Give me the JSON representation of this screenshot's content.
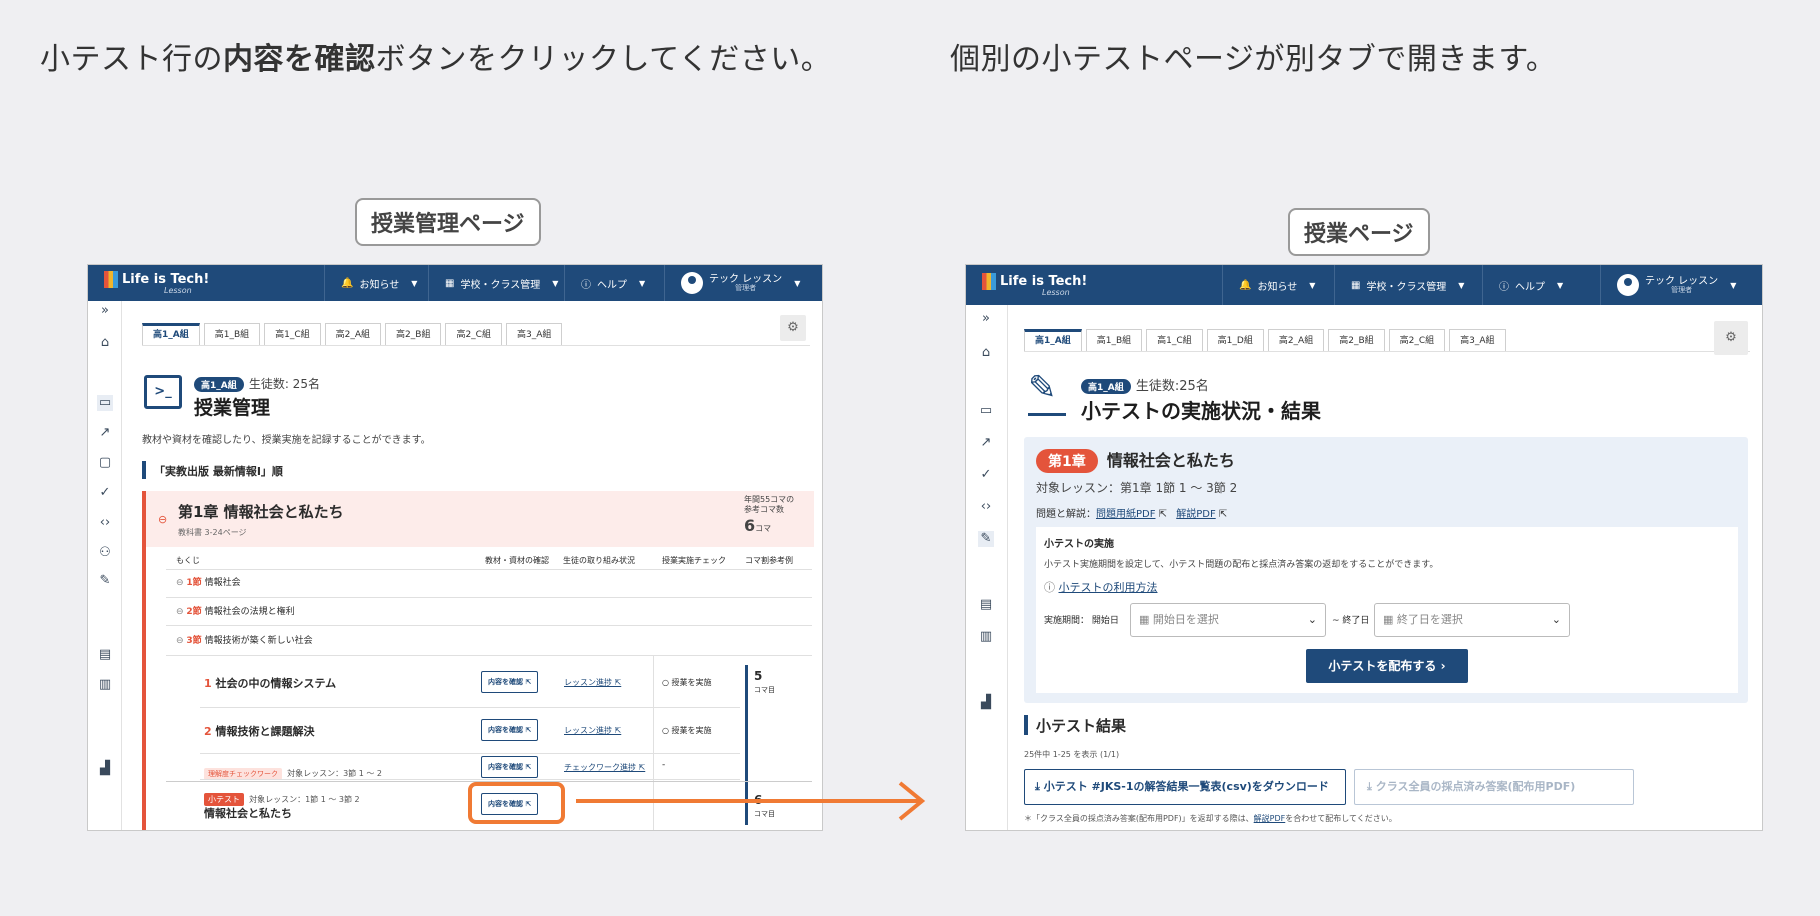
{
  "captions": {
    "left_prefix": "小テスト行の",
    "left_bold": "内容を確認",
    "left_suffix": "ボタンをクリックしてください。",
    "right": "個別の小テストページが別タブで開きます。"
  },
  "labels": {
    "left": "授業管理ページ",
    "right": "授業ページ"
  },
  "topbar": {
    "logo": "Life is Tech!",
    "logo_sub": "Lesson",
    "notice": "お知らせ",
    "school": "学校・クラス管理",
    "help": "ヘルプ",
    "user_name": "テック レッスン",
    "user_role": "管理者"
  },
  "left": {
    "tabs": [
      "高1_A組",
      "高1_B組",
      "高1_C組",
      "高2_A組",
      "高2_B組",
      "高2_C組",
      "高3_A組"
    ],
    "class_badge": "高1_A組",
    "students": "生徒数: 25名",
    "title": "授業管理",
    "description": "教材や資材を確認したり、授業実施を記録することができます。",
    "textbook": "「実教出版 最新情報Ⅰ」順",
    "chapter_title": "第1章 情報社会と私たち",
    "chapter_pages": "教科書 3-24ページ",
    "annual_label": "年間55コマの",
    "annual_label2": "参考コマ数",
    "annual_value": "6",
    "annual_unit": "コマ",
    "col_toc": "もくじ",
    "col_material": "教材・資材の確認",
    "col_progress": "生徒の取り組み状況",
    "col_check": "授業実施チェック",
    "col_ref": "コマ割参考例",
    "sections": [
      {
        "num": "1節",
        "title": "情報社会"
      },
      {
        "num": "2節",
        "title": "情報社会の法規と権利"
      },
      {
        "num": "3節",
        "title": "情報技術が築く新しい社会"
      }
    ],
    "lesson1_num": "1",
    "lesson1_title": "社会の中の情報システム",
    "lesson2_num": "2",
    "lesson2_title": "情報技術と課題解決",
    "check_btn": "内容を確認",
    "progress_link": "レッスン進捗",
    "implement": "授業を実施",
    "understanding_badge": "理解度チェックワーク",
    "understanding_target": "対象レッスン：3節 1 ～ 2",
    "checkwork_link": "チェックワーク進捗",
    "dash": "-",
    "quiz_badge": "小テスト",
    "quiz_target": "対象レッスン：1節 1 ～ 3節 2",
    "quiz_title": "情報社会と私たち",
    "koma5": "5",
    "koma6": "6",
    "koma_unit": "コマ目"
  },
  "right": {
    "tabs": [
      "高1_A組",
      "高1_B組",
      "高1_C組",
      "高1_D組",
      "高2_A組",
      "高2_B組",
      "高2_C組",
      "高3_A組"
    ],
    "class_badge": "高1_A組",
    "students": "生徒数:25名",
    "title": "小テストの実施状況・結果",
    "chapter_badge": "第1章",
    "chapter_title": "情報社会と私たち",
    "target": "対象レッスン：第1章 1節 1 ～ 3節 2",
    "problems_label": "問題と解説：",
    "problem_pdf": "問題用紙PDF",
    "answer_pdf": "解説PDF",
    "impl_title": "小テストの実施",
    "impl_desc": "小テスト実施期間を設定して、小テスト問題の配布と採点済み答案の返却をすることができます。",
    "howto": "小テストの利用方法",
    "period_label": "実施期間：",
    "start_label": "開始日",
    "start_placeholder": "開始日を選択",
    "tilde": "~",
    "end_label": "終了日",
    "end_placeholder": "終了日を選択",
    "distribute": "小テストを配布する",
    "results_title": "小テスト結果",
    "count": "25件中 1-25 を表示 (1/1)",
    "download_csv": "小テスト #JKS-1の解答結果一覧表(csv)をダウンロード",
    "download_pdf": "クラス全員の採点済み答案(配布用PDF)",
    "note_prefix": "＊「クラス全員の採点済み答案(配布用PDF)」を返却する際は、",
    "note_link": "解説PDF",
    "note_suffix": "を合わせて配布してください。"
  },
  "colors": {
    "navy": "#1f4a7a",
    "accent": "#e4543b",
    "arrow": "#f07a34"
  }
}
